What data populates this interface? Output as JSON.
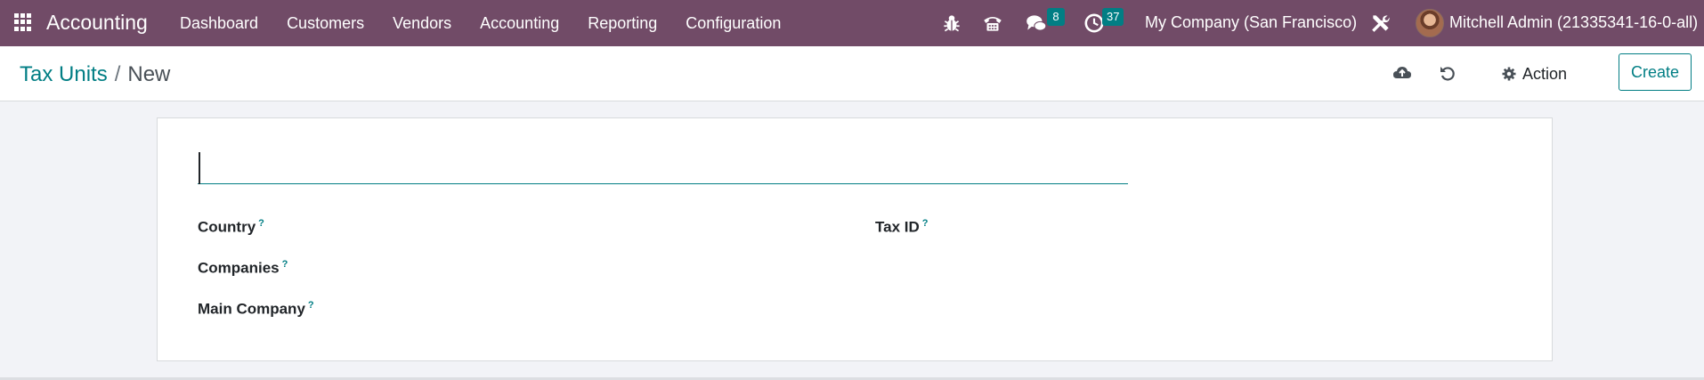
{
  "navbar": {
    "app_name": "Accounting",
    "menu": [
      "Dashboard",
      "Customers",
      "Vendors",
      "Accounting",
      "Reporting",
      "Configuration"
    ],
    "messages_count": "8",
    "activities_count": "37",
    "company": "My Company (San Francisco)",
    "user": "Mitchell Admin (21335341-16-0-all)"
  },
  "control_panel": {
    "breadcrumb_parent": "Tax Units",
    "breadcrumb_separator": "/",
    "breadcrumb_current": "New",
    "action_label": "Action",
    "create_label": "Create"
  },
  "form": {
    "name_value": "",
    "tooltip_mark": "?",
    "fields": {
      "country": "Country",
      "companies": "Companies",
      "main_company": "Main Company",
      "tax_id": "Tax ID"
    }
  },
  "colors": {
    "navbar_bg": "#714b67",
    "accent": "#017e84",
    "background": "#f2f3f7"
  },
  "icons": [
    "apps-grid-icon",
    "bug-icon",
    "phone-icon",
    "chat-icon",
    "clock-icon",
    "tools-icon",
    "cloud-upload-icon",
    "undo-icon",
    "gear-icon"
  ]
}
